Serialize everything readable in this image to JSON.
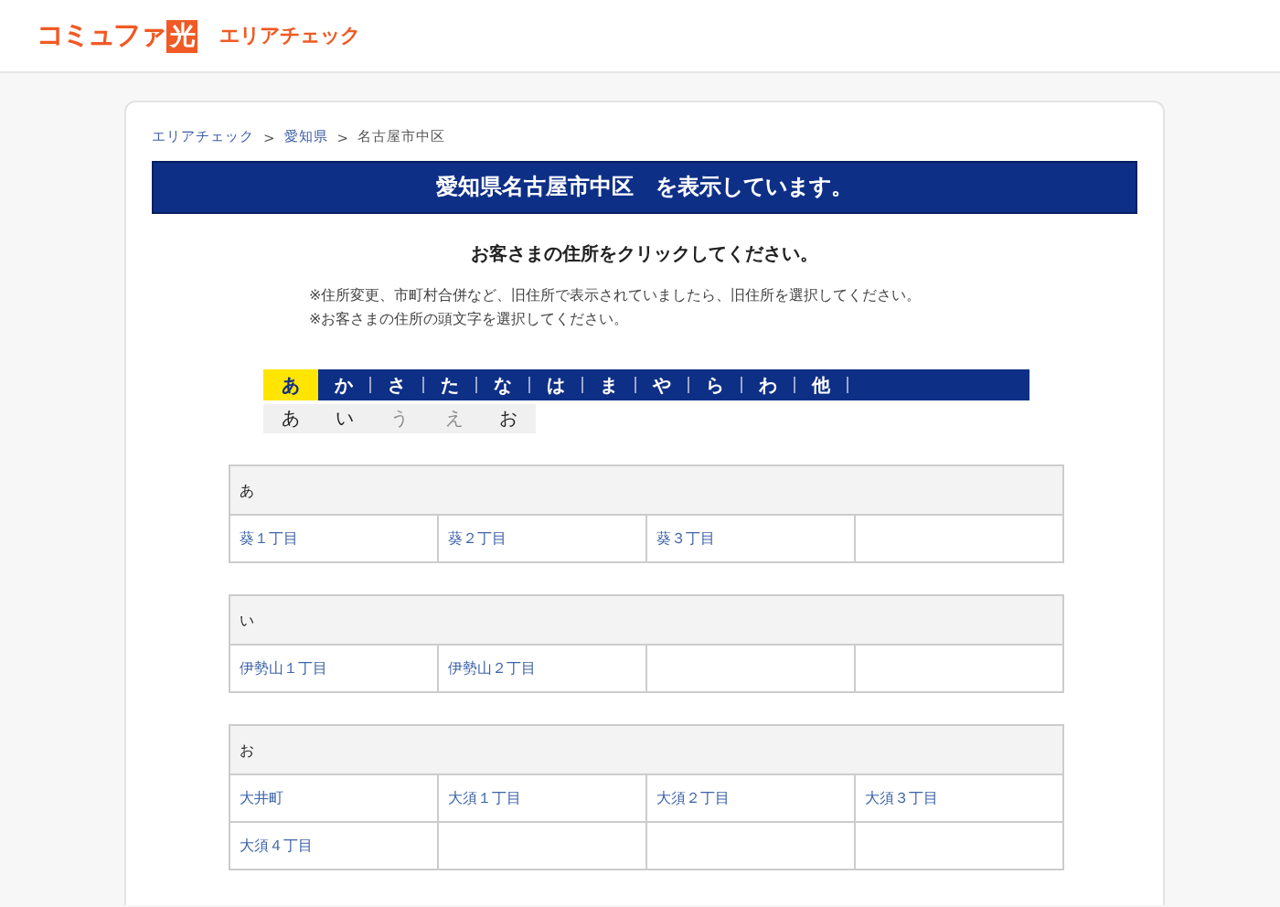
{
  "header": {
    "logo": "コミュファ",
    "logo_mark": "光",
    "subtitle": "エリアチェック"
  },
  "breadcrumb": {
    "separator": ">",
    "items": [
      {
        "label": "エリアチェック",
        "link": true
      },
      {
        "label": "愛知県",
        "link": true
      },
      {
        "label": "名古屋市中区",
        "link": false
      }
    ]
  },
  "title": "愛知県名古屋市中区　を表示しています。",
  "instruction": "お客さまの住所をクリックしてください。",
  "notes": [
    "※住所変更、市町村合併など、旧住所で表示されていましたら、旧住所を選択してください。",
    "※お客さまの住所の頭文字を選択してください。"
  ],
  "kana_tabs": [
    {
      "label": "あ",
      "selected": true
    },
    {
      "label": "か",
      "selected": false
    },
    {
      "label": "さ",
      "selected": false
    },
    {
      "label": "た",
      "selected": false
    },
    {
      "label": "な",
      "selected": false
    },
    {
      "label": "は",
      "selected": false
    },
    {
      "label": "ま",
      "selected": false
    },
    {
      "label": "や",
      "selected": false
    },
    {
      "label": "ら",
      "selected": false
    },
    {
      "label": "わ",
      "selected": false
    },
    {
      "label": "他",
      "selected": false
    }
  ],
  "kana_sub": [
    {
      "label": "あ",
      "disabled": false
    },
    {
      "label": "い",
      "disabled": false
    },
    {
      "label": "う",
      "disabled": true
    },
    {
      "label": "え",
      "disabled": true
    },
    {
      "label": "お",
      "disabled": false
    }
  ],
  "sections": [
    {
      "heading": "あ",
      "addresses": [
        "葵１丁目",
        "葵２丁目",
        "葵３丁目"
      ]
    },
    {
      "heading": "い",
      "addresses": [
        "伊勢山１丁目",
        "伊勢山２丁目"
      ]
    },
    {
      "heading": "お",
      "addresses": [
        "大井町",
        "大須１丁目",
        "大須２丁目",
        "大須３丁目",
        "大須４丁目"
      ]
    }
  ]
}
